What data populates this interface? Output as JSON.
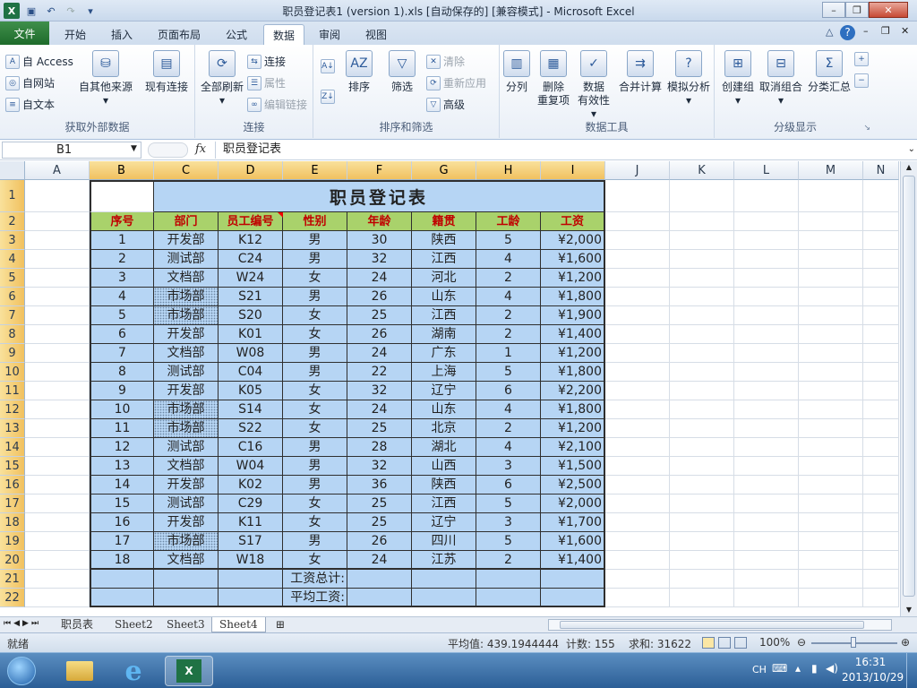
{
  "window": {
    "title": "职员登记表1 (version 1).xls  [自动保存的]  [兼容模式] - Microsoft Excel"
  },
  "tabs": [
    "文件",
    "开始",
    "插入",
    "页面布局",
    "公式",
    "数据",
    "审阅",
    "视图"
  ],
  "ribbon": {
    "get_external": {
      "access": "自 Access",
      "web": "自网站",
      "text": "自文本",
      "other": "自其他来源",
      "existing": "现有连接",
      "label": "获取外部数据"
    },
    "connections": {
      "refresh_all": "全部刷新",
      "connections": "连接",
      "properties": "属性",
      "edit_links": "编辑链接",
      "label": "连接"
    },
    "sort_filter": {
      "sort": "排序",
      "filter": "筛选",
      "clear": "清除",
      "reapply": "重新应用",
      "advanced": "高级",
      "label": "排序和筛选"
    },
    "data_tools": {
      "text_to_columns": "分列",
      "remove_dup_1": "删除",
      "remove_dup_2": "重复项",
      "validation_1": "数据",
      "validation_2": "有效性",
      "consolidate": "合并计算",
      "what_if": "模拟分析",
      "label": "数据工具"
    },
    "outline": {
      "group": "创建组",
      "ungroup": "取消组合",
      "subtotal": "分类汇总",
      "label": "分级显示"
    }
  },
  "formula_bar": {
    "name_box": "B1",
    "fx": "fx",
    "content": "职员登记表"
  },
  "columns": [
    "A",
    "B",
    "C",
    "D",
    "E",
    "F",
    "G",
    "H",
    "I",
    "J",
    "K",
    "L",
    "M",
    "N"
  ],
  "sheet": {
    "title": "职员登记表",
    "headers": [
      "序号",
      "部门",
      "员工编号",
      "性别",
      "年龄",
      "籍贯",
      "工龄",
      "工资"
    ],
    "rows": [
      [
        "1",
        "开发部",
        "K12",
        "男",
        "30",
        "陕西",
        "5",
        "¥2,000"
      ],
      [
        "2",
        "测试部",
        "C24",
        "男",
        "32",
        "江西",
        "4",
        "¥1,600"
      ],
      [
        "3",
        "文档部",
        "W24",
        "女",
        "24",
        "河北",
        "2",
        "¥1,200"
      ],
      [
        "4",
        "市场部",
        "S21",
        "男",
        "26",
        "山东",
        "4",
        "¥1,800"
      ],
      [
        "5",
        "市场部",
        "S20",
        "女",
        "25",
        "江西",
        "2",
        "¥1,900"
      ],
      [
        "6",
        "开发部",
        "K01",
        "女",
        "26",
        "湖南",
        "2",
        "¥1,400"
      ],
      [
        "7",
        "文档部",
        "W08",
        "男",
        "24",
        "广东",
        "1",
        "¥1,200"
      ],
      [
        "8",
        "测试部",
        "C04",
        "男",
        "22",
        "上海",
        "5",
        "¥1,800"
      ],
      [
        "9",
        "开发部",
        "K05",
        "女",
        "32",
        "辽宁",
        "6",
        "¥2,200"
      ],
      [
        "10",
        "市场部",
        "S14",
        "女",
        "24",
        "山东",
        "4",
        "¥1,800"
      ],
      [
        "11",
        "市场部",
        "S22",
        "女",
        "25",
        "北京",
        "2",
        "¥1,200"
      ],
      [
        "12",
        "测试部",
        "C16",
        "男",
        "28",
        "湖北",
        "4",
        "¥2,100"
      ],
      [
        "13",
        "文档部",
        "W04",
        "男",
        "32",
        "山西",
        "3",
        "¥1,500"
      ],
      [
        "14",
        "开发部",
        "K02",
        "男",
        "36",
        "陕西",
        "6",
        "¥2,500"
      ],
      [
        "15",
        "测试部",
        "C29",
        "女",
        "25",
        "江西",
        "5",
        "¥2,000"
      ],
      [
        "16",
        "开发部",
        "K11",
        "女",
        "25",
        "辽宁",
        "3",
        "¥1,700"
      ],
      [
        "17",
        "市场部",
        "S17",
        "男",
        "26",
        "四川",
        "5",
        "¥1,600"
      ],
      [
        "18",
        "文档部",
        "W18",
        "女",
        "24",
        "江苏",
        "2",
        "¥1,400"
      ]
    ],
    "total_label": "工资总计:",
    "avg_label": "平均工资:"
  },
  "sheet_tabs": [
    "职员表",
    "Sheet2",
    "Sheet3",
    "Sheet4"
  ],
  "status": {
    "ready": "就绪",
    "average": "平均值: 439.1944444",
    "count": "计数: 155",
    "sum": "求和: 31622",
    "zoom": "100%"
  },
  "taskbar": {
    "ime": "CH",
    "time": "16:31",
    "date": "2013/10/29"
  }
}
